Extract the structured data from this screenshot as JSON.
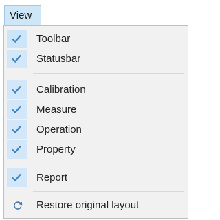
{
  "menu": {
    "title": "View"
  },
  "items": [
    {
      "label": "Toolbar",
      "checked": true
    },
    {
      "label": "Statusbar",
      "checked": true
    },
    {
      "label": "Calibration",
      "checked": true
    },
    {
      "label": "Measure",
      "checked": true
    },
    {
      "label": "Operation",
      "checked": true
    },
    {
      "label": "Property",
      "checked": true
    },
    {
      "label": "Report",
      "checked": true
    },
    {
      "label": "Restore original layout",
      "icon": "refresh-icon"
    }
  ],
  "colors": {
    "menu_highlight": "#cde6f8",
    "check_background": "#d3e7f8",
    "check_mark": "#3a86c8",
    "menu_background": "#f1f1f1"
  }
}
